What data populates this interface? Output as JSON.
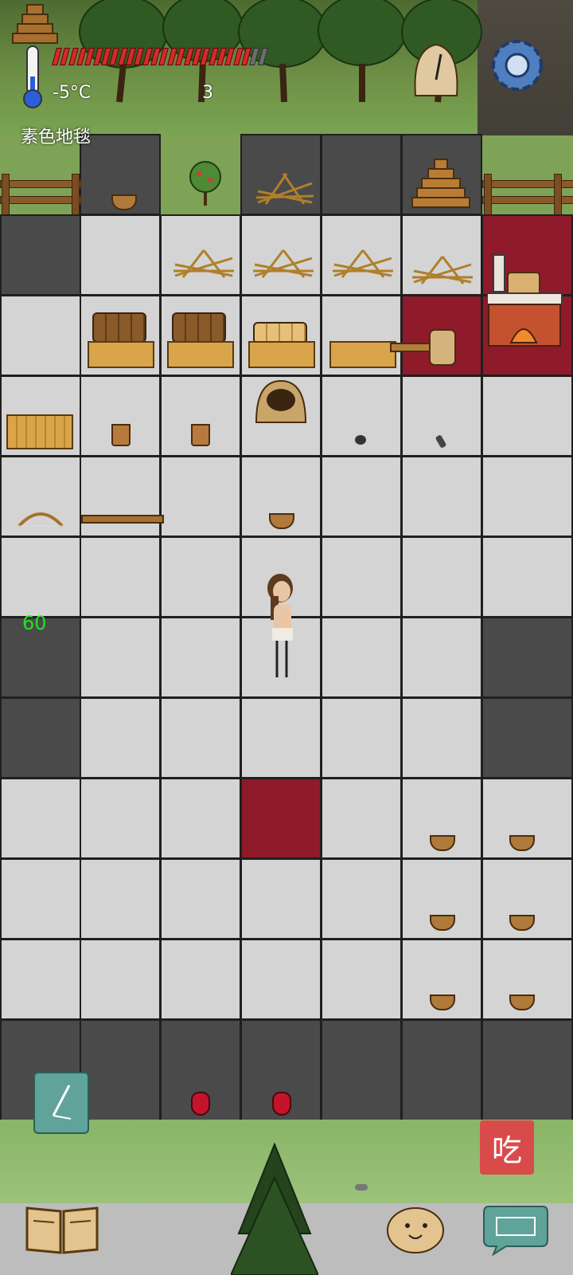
{
  "hud": {
    "temperature": "-5°C",
    "counter": "3",
    "held_item": "素色地毯",
    "fps": "60",
    "health_filled": 24,
    "health_total": 26
  },
  "buttons": {
    "eat_label": "吃"
  },
  "colors": {
    "health": "#d42a2a",
    "carpet": "#8e1a2a",
    "floor": "#d4d4d4",
    "fps": "#25e025"
  },
  "icons": [
    "thermometer-icon",
    "settings-gear-icon",
    "sundial-icon",
    "pencil-icon",
    "recipe-book-icon",
    "emote-face-icon",
    "keyboard-icon"
  ]
}
